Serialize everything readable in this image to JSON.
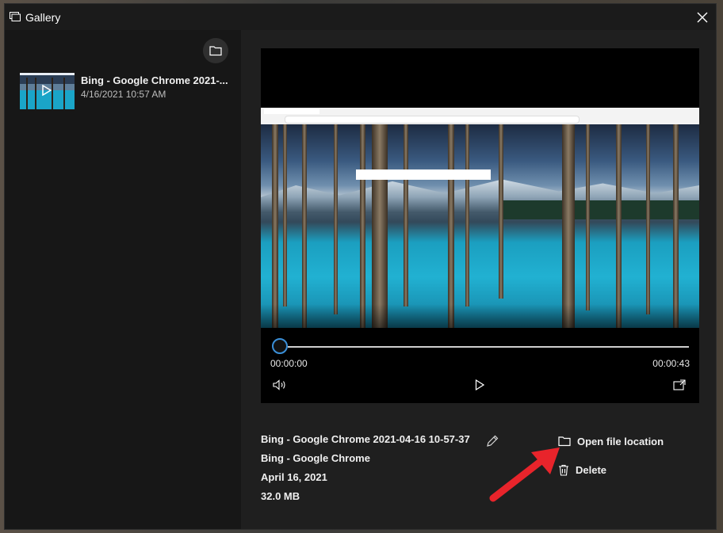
{
  "window": {
    "title": "Gallery"
  },
  "gallery": {
    "items": [
      {
        "title": "Bing - Google Chrome 2021-...",
        "date": "4/16/2021 10:57 AM"
      }
    ]
  },
  "player": {
    "time_current": "00:00:00",
    "time_total": "00:00:43",
    "progress_fraction": 0
  },
  "details": {
    "filename": "Bing - Google Chrome 2021-04-16 10-57-37",
    "app": "Bing - Google Chrome",
    "date": "April 16, 2021",
    "size": "32.0 MB"
  },
  "actions": {
    "open_location": "Open file location",
    "delete": "Delete"
  },
  "colors": {
    "accent": "#3a8fd8",
    "annotation_arrow": "#e8242b"
  },
  "icons": [
    "gallery-icon",
    "close-icon",
    "folder-icon",
    "play-icon",
    "volume-icon",
    "expand-icon",
    "edit-icon",
    "trash-icon"
  ]
}
